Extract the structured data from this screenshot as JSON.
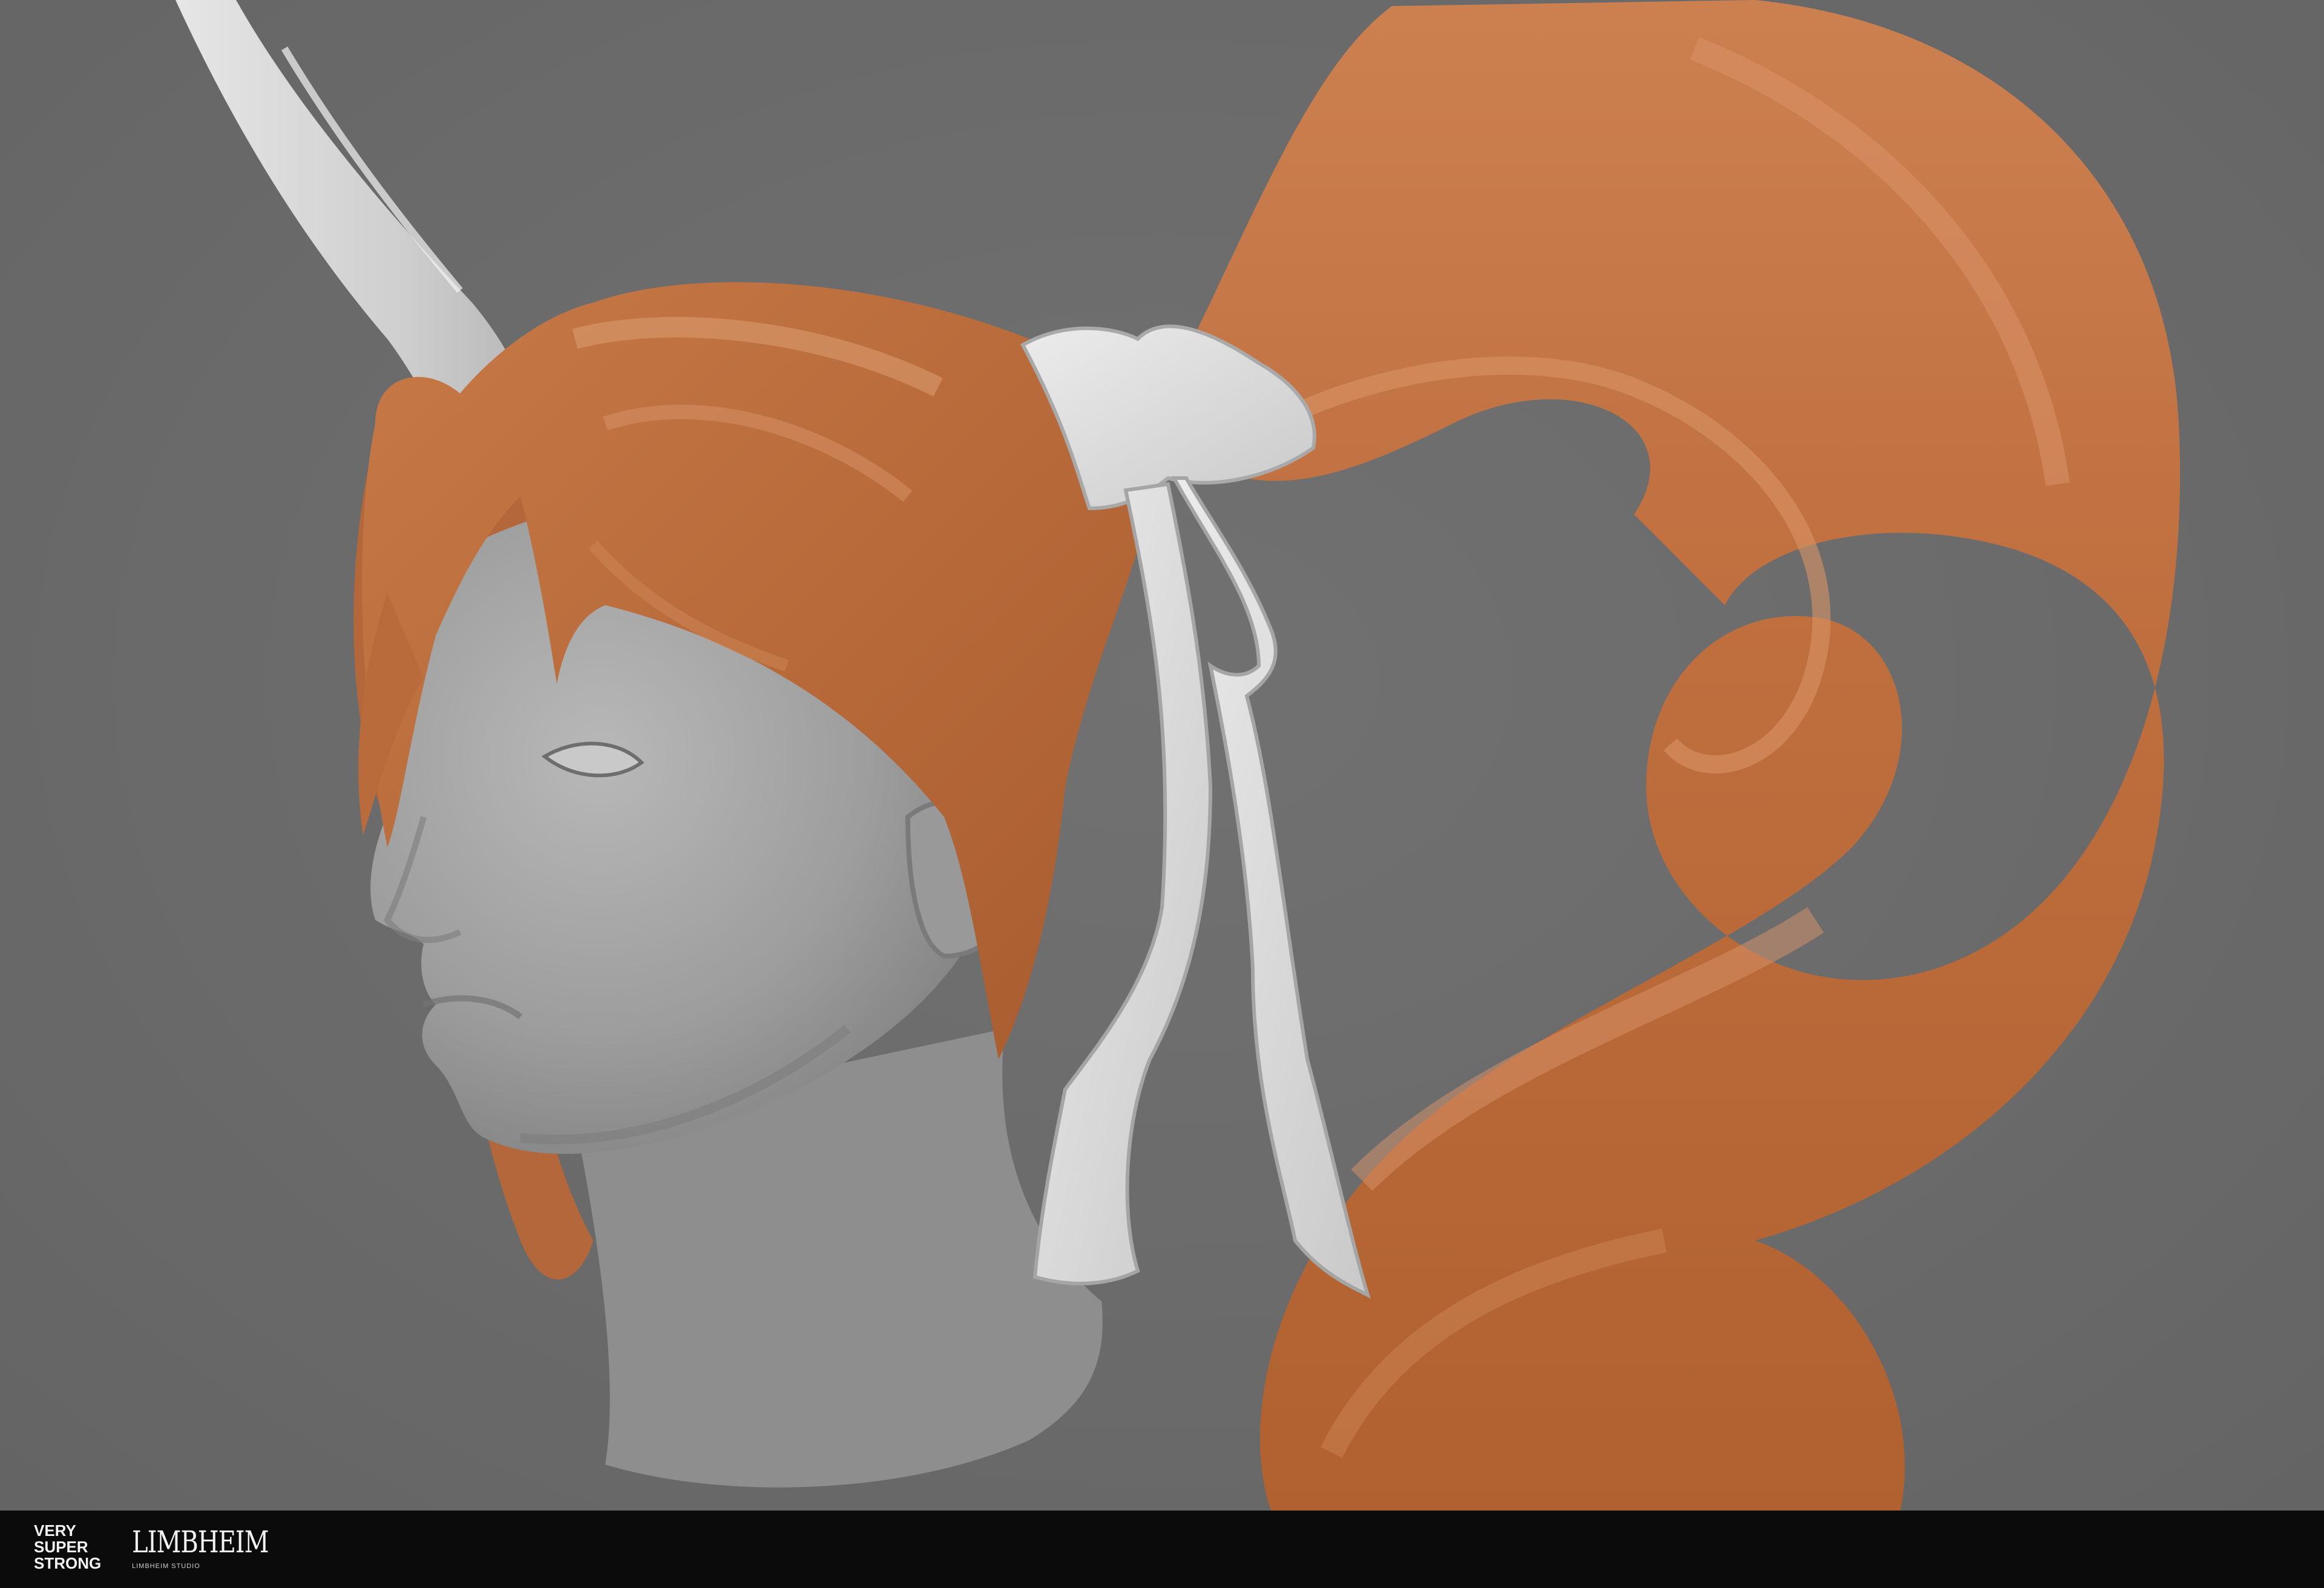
{
  "footer": {
    "vss_line1": "VERY",
    "vss_line2": "SUPER",
    "vss_line3": "STRONG",
    "limbheim_logo": "LIMBHEIM",
    "limbheim_sub": "LIMBHEIM STUDIO"
  },
  "colors": {
    "background": "#6b6b6b",
    "hair": "#c0703f",
    "clay": "#a9a9a9",
    "ribbon": "#e2e2e2",
    "footer": "#0b0b0b"
  }
}
